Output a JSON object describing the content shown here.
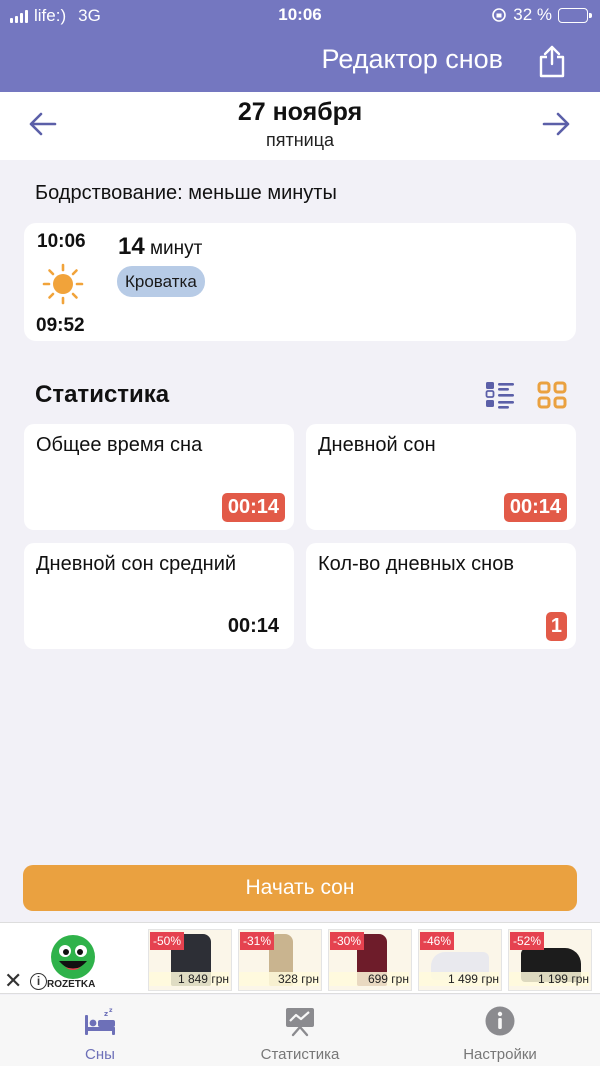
{
  "status_bar": {
    "carrier": "life:)",
    "network": "3G",
    "time": "10:06",
    "battery": "32 %"
  },
  "nav": {
    "title": "Редактор снов",
    "share_icon": "share-icon"
  },
  "date_header": {
    "date": "27 ноября",
    "weekday": "пятница"
  },
  "awake_text": "Бодрствование: меньше минуты",
  "sleep_entry": {
    "end_time": "10:06",
    "start_time": "09:52",
    "duration_value": "14",
    "duration_unit": "минут",
    "location": "Кроватка",
    "icon": "sun-icon"
  },
  "stats": {
    "title": "Статистика",
    "cards": [
      {
        "label": "Общее время сна",
        "value": "00:14"
      },
      {
        "label": "Дневной сон",
        "value": "00:14"
      },
      {
        "label": "Дневной сон средний",
        "value": "00:14"
      },
      {
        "label": "Кол-во дневных снов",
        "value": "1"
      }
    ]
  },
  "start_button": "Начать сон",
  "ad": {
    "brand": "ROZETKA",
    "products": [
      {
        "discount": "-50%",
        "price": "1 849 грн"
      },
      {
        "discount": "-31%",
        "price": "328 грн"
      },
      {
        "discount": "-30%",
        "price": "699 грн"
      },
      {
        "discount": "-46%",
        "price": "1 499 грн"
      },
      {
        "discount": "-52%",
        "price": "1 199 грн"
      }
    ]
  },
  "tabs": [
    {
      "label": "Сны",
      "icon": "bed-icon"
    },
    {
      "label": "Статистика",
      "icon": "chart-board-icon"
    },
    {
      "label": "Настройки",
      "icon": "info-icon"
    }
  ],
  "colors": {
    "header": "#7477c0",
    "accent_orange": "#eaa140",
    "badge_red": "#e25a48",
    "tag_blue": "#b7cbe6"
  }
}
